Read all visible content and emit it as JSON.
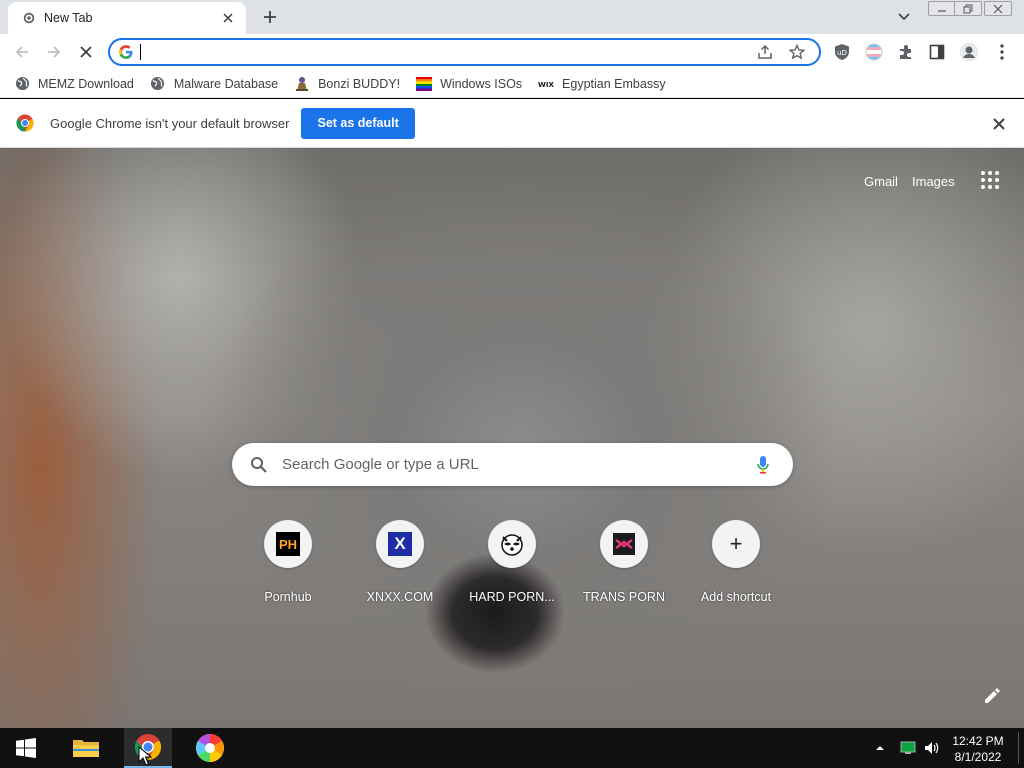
{
  "tab": {
    "title": "New Tab"
  },
  "omnibox": {
    "value": "",
    "placeholder": ""
  },
  "bookmarks": [
    {
      "label": "MEMZ Download",
      "icon": "globe-icon"
    },
    {
      "label": "Malware Database",
      "icon": "globe-icon"
    },
    {
      "label": "Bonzi BUDDY!",
      "icon": "bonzi-icon"
    },
    {
      "label": "Windows ISOs",
      "icon": "windows-flag-icon"
    },
    {
      "label": "Egyptian Embassy",
      "icon": "wix-icon"
    }
  ],
  "infobar": {
    "message": "Google Chrome isn't your default browser",
    "button": "Set as default"
  },
  "ntp": {
    "gmail": "Gmail",
    "images": "Images",
    "search_placeholder": "Search Google or type a URL",
    "shortcuts": [
      {
        "label": "Pornhub",
        "icon_text": "PH"
      },
      {
        "label": "XNXX.COM",
        "icon_text": "X"
      },
      {
        "label": "HARD PORN...",
        "icon_text": ""
      },
      {
        "label": "TRANS PORN",
        "icon_text": ""
      },
      {
        "label": "Add shortcut",
        "icon_text": "+"
      }
    ]
  },
  "taskbar": {
    "time": "12:42 PM",
    "date": "8/1/2022"
  },
  "colors": {
    "accent": "#1a73e8",
    "taskbar": "#101010"
  }
}
